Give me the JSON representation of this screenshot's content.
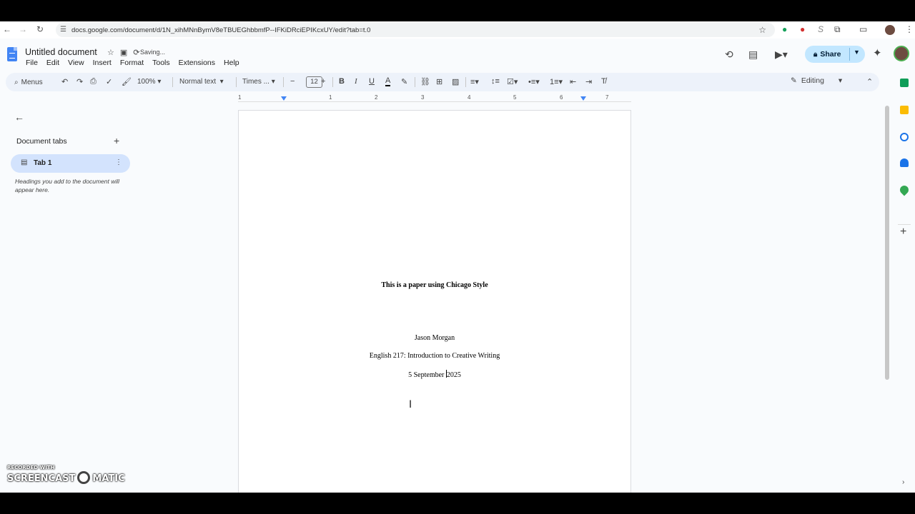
{
  "browser": {
    "url": "docs.google.com/document/d/1N_xihMNnBymV8eTBUEGhbbmfP--IFKiDRciEPIKcxUY/edit?tab=t.0"
  },
  "doc": {
    "title": "Untitled document",
    "status": "Saving...",
    "menus": [
      "File",
      "Edit",
      "View",
      "Insert",
      "Format",
      "Tools",
      "Extensions",
      "Help"
    ],
    "share_label": "Share"
  },
  "toolbar": {
    "search_label": "Menus",
    "zoom": "100%",
    "style": "Normal text",
    "font": "Times ...",
    "font_size": "12",
    "mode": "Editing"
  },
  "ruler": {
    "ticks": [
      "1",
      "1",
      "2",
      "3",
      "4",
      "5",
      "6",
      "7"
    ]
  },
  "sidebar": {
    "heading": "Document tabs",
    "tab_label": "Tab 1",
    "hint": "Headings you add to the document will appear here."
  },
  "page": {
    "title": "This is a paper using Chicago Style",
    "author": "Jason Morgan",
    "course": "English 217: Introduction to Creative Writing",
    "date_before_cursor": "5 September ",
    "date_after_cursor": "2025"
  },
  "watermark": {
    "line1": "RECORDED WITH",
    "line2a": "SCREENCAST",
    "line2b": "MATIC"
  },
  "colors": {
    "accent": "#c2e7ff",
    "tab_active": "#d3e3fd",
    "toolbar_bg": "#edf2fa",
    "docs_blue": "#4285f4"
  }
}
